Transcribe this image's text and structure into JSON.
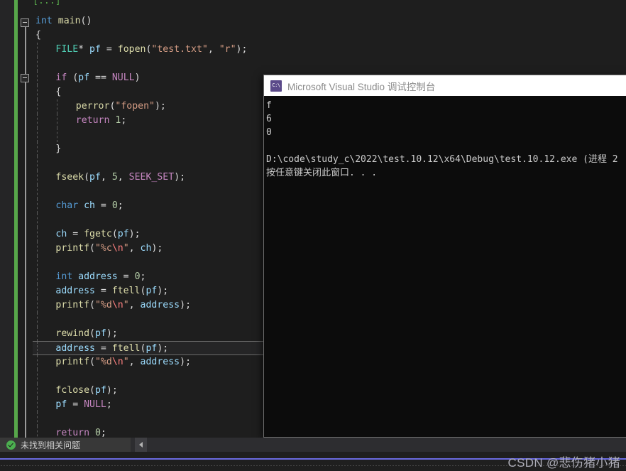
{
  "editor": {
    "top_partial_comment": "[...]",
    "current_line_index": 24,
    "lines": [
      {
        "indent": 0,
        "tokens": []
      },
      {
        "indent": 0,
        "tokens": [
          {
            "t": "int ",
            "c": "k"
          },
          {
            "t": "main",
            "c": "fn"
          },
          {
            "t": "()",
            "c": "pr"
          }
        ]
      },
      {
        "indent": 0,
        "tokens": [
          {
            "t": "{",
            "c": "p"
          }
        ]
      },
      {
        "indent": 1,
        "tokens": [
          {
            "t": "FILE",
            "c": "typ"
          },
          {
            "t": "* ",
            "c": "p"
          },
          {
            "t": "pf",
            "c": "var"
          },
          {
            "t": " = ",
            "c": "p"
          },
          {
            "t": "fopen",
            "c": "fn"
          },
          {
            "t": "(",
            "c": "pr"
          },
          {
            "t": "\"test.txt\"",
            "c": "str"
          },
          {
            "t": ", ",
            "c": "p"
          },
          {
            "t": "\"r\"",
            "c": "str"
          },
          {
            "t": ")",
            "c": "pr"
          },
          {
            "t": ";",
            "c": "p"
          }
        ]
      },
      {
        "indent": 1,
        "tokens": []
      },
      {
        "indent": 1,
        "tokens": [
          {
            "t": "if ",
            "c": "kw"
          },
          {
            "t": "(",
            "c": "pr"
          },
          {
            "t": "pf",
            "c": "var"
          },
          {
            "t": " == ",
            "c": "p"
          },
          {
            "t": "NULL",
            "c": "mac"
          },
          {
            "t": ")",
            "c": "pr"
          }
        ]
      },
      {
        "indent": 1,
        "tokens": [
          {
            "t": "{",
            "c": "p"
          }
        ]
      },
      {
        "indent": 2,
        "tokens": [
          {
            "t": "perror",
            "c": "fn"
          },
          {
            "t": "(",
            "c": "pr"
          },
          {
            "t": "\"fopen\"",
            "c": "str"
          },
          {
            "t": ")",
            "c": "pr"
          },
          {
            "t": ";",
            "c": "p"
          }
        ]
      },
      {
        "indent": 2,
        "tokens": [
          {
            "t": "return ",
            "c": "kw"
          },
          {
            "t": "1",
            "c": "num"
          },
          {
            "t": ";",
            "c": "p"
          }
        ]
      },
      {
        "indent": 2,
        "tokens": []
      },
      {
        "indent": 1,
        "tokens": [
          {
            "t": "}",
            "c": "p"
          }
        ]
      },
      {
        "indent": 1,
        "tokens": []
      },
      {
        "indent": 1,
        "tokens": [
          {
            "t": "fseek",
            "c": "fn"
          },
          {
            "t": "(",
            "c": "pr"
          },
          {
            "t": "pf",
            "c": "var"
          },
          {
            "t": ", ",
            "c": "p"
          },
          {
            "t": "5",
            "c": "num"
          },
          {
            "t": ", ",
            "c": "p"
          },
          {
            "t": "SEEK_SET",
            "c": "mac"
          },
          {
            "t": ")",
            "c": "pr"
          },
          {
            "t": ";",
            "c": "p"
          }
        ]
      },
      {
        "indent": 1,
        "tokens": []
      },
      {
        "indent": 1,
        "tokens": [
          {
            "t": "char ",
            "c": "k"
          },
          {
            "t": "ch",
            "c": "var"
          },
          {
            "t": " = ",
            "c": "p"
          },
          {
            "t": "0",
            "c": "num"
          },
          {
            "t": ";",
            "c": "p"
          }
        ]
      },
      {
        "indent": 1,
        "tokens": []
      },
      {
        "indent": 1,
        "tokens": [
          {
            "t": "ch",
            "c": "var"
          },
          {
            "t": " = ",
            "c": "p"
          },
          {
            "t": "fgetc",
            "c": "fn"
          },
          {
            "t": "(",
            "c": "pr"
          },
          {
            "t": "pf",
            "c": "var"
          },
          {
            "t": ")",
            "c": "pr"
          },
          {
            "t": ";",
            "c": "p"
          }
        ]
      },
      {
        "indent": 1,
        "tokens": [
          {
            "t": "printf",
            "c": "fn"
          },
          {
            "t": "(",
            "c": "pr"
          },
          {
            "t": "\"%c",
            "c": "str"
          },
          {
            "t": "\\n",
            "c": "esc"
          },
          {
            "t": "\"",
            "c": "str"
          },
          {
            "t": ", ",
            "c": "p"
          },
          {
            "t": "ch",
            "c": "var"
          },
          {
            "t": ")",
            "c": "pr"
          },
          {
            "t": ";",
            "c": "p"
          }
        ]
      },
      {
        "indent": 1,
        "tokens": []
      },
      {
        "indent": 1,
        "tokens": [
          {
            "t": "int ",
            "c": "k"
          },
          {
            "t": "address",
            "c": "var"
          },
          {
            "t": " = ",
            "c": "p"
          },
          {
            "t": "0",
            "c": "num"
          },
          {
            "t": ";",
            "c": "p"
          }
        ]
      },
      {
        "indent": 1,
        "tokens": [
          {
            "t": "address",
            "c": "var"
          },
          {
            "t": " = ",
            "c": "p"
          },
          {
            "t": "ftell",
            "c": "fn"
          },
          {
            "t": "(",
            "c": "pr"
          },
          {
            "t": "pf",
            "c": "var"
          },
          {
            "t": ")",
            "c": "pr"
          },
          {
            "t": ";",
            "c": "p"
          }
        ]
      },
      {
        "indent": 1,
        "tokens": [
          {
            "t": "printf",
            "c": "fn"
          },
          {
            "t": "(",
            "c": "pr"
          },
          {
            "t": "\"%d",
            "c": "str"
          },
          {
            "t": "\\n",
            "c": "esc"
          },
          {
            "t": "\"",
            "c": "str"
          },
          {
            "t": ", ",
            "c": "p"
          },
          {
            "t": "address",
            "c": "var"
          },
          {
            "t": ")",
            "c": "pr"
          },
          {
            "t": ";",
            "c": "p"
          }
        ]
      },
      {
        "indent": 1,
        "tokens": []
      },
      {
        "indent": 1,
        "tokens": [
          {
            "t": "rewind",
            "c": "fn"
          },
          {
            "t": "(",
            "c": "pr"
          },
          {
            "t": "pf",
            "c": "var"
          },
          {
            "t": ")",
            "c": "pr"
          },
          {
            "t": ";",
            "c": "p"
          }
        ]
      },
      {
        "indent": 1,
        "tokens": [
          {
            "t": "address",
            "c": "var"
          },
          {
            "t": " = ",
            "c": "p"
          },
          {
            "t": "ftell",
            "c": "fn"
          },
          {
            "t": "(",
            "c": "pr"
          },
          {
            "t": "pf",
            "c": "var"
          },
          {
            "t": ")",
            "c": "pr"
          },
          {
            "t": ";",
            "c": "p"
          }
        ]
      },
      {
        "indent": 1,
        "tokens": [
          {
            "t": "printf",
            "c": "fn"
          },
          {
            "t": "(",
            "c": "pr"
          },
          {
            "t": "\"%d",
            "c": "str"
          },
          {
            "t": "\\n",
            "c": "esc"
          },
          {
            "t": "\"",
            "c": "str"
          },
          {
            "t": ", ",
            "c": "p"
          },
          {
            "t": "address",
            "c": "var"
          },
          {
            "t": ")",
            "c": "pr"
          },
          {
            "t": ";",
            "c": "p"
          }
        ]
      },
      {
        "indent": 1,
        "tokens": []
      },
      {
        "indent": 1,
        "tokens": [
          {
            "t": "fclose",
            "c": "fn"
          },
          {
            "t": "(",
            "c": "pr"
          },
          {
            "t": "pf",
            "c": "var"
          },
          {
            "t": ")",
            "c": "pr"
          },
          {
            "t": ";",
            "c": "p"
          }
        ]
      },
      {
        "indent": 1,
        "tokens": [
          {
            "t": "pf",
            "c": "var"
          },
          {
            "t": " = ",
            "c": "p"
          },
          {
            "t": "NULL",
            "c": "mac"
          },
          {
            "t": ";",
            "c": "p"
          }
        ]
      },
      {
        "indent": 1,
        "tokens": []
      },
      {
        "indent": 1,
        "tokens": [
          {
            "t": "return ",
            "c": "kw"
          },
          {
            "t": "0",
            "c": "num"
          },
          {
            "t": ";",
            "c": "p"
          }
        ]
      }
    ]
  },
  "console": {
    "title": "Microsoft Visual Studio 调试控制台",
    "icon": "command-prompt-icon",
    "icon_glyph": "C:\\",
    "output": [
      "f",
      "6",
      "0",
      "",
      "D:\\code\\study_c\\2022\\test.10.12\\x64\\Debug\\test.10.12.exe (进程 2",
      "按任意键关闭此窗口. . ."
    ]
  },
  "status_bar": {
    "icon": "success-check-icon",
    "text": "未找到相关问题",
    "scroll_left_arrow": "left-arrow-icon"
  },
  "footer": {
    "watermark": "CSDN @悲伤猪小猪"
  },
  "colors": {
    "editor_background": "#1e1e1e",
    "change_bar_green": "#57a64a",
    "console_background": "#0c0c0c",
    "console_titlebar": "#ffffff",
    "status_bar": "#2d2d30",
    "accent_rule": "#6a6ae0",
    "keyword_purple": "#c586c0",
    "type_teal": "#4ec9b0",
    "function_yellow": "#dcdcaa",
    "variable_blue": "#9cdcfe",
    "string_salmon": "#d69d85",
    "number_green": "#b5cea8"
  }
}
